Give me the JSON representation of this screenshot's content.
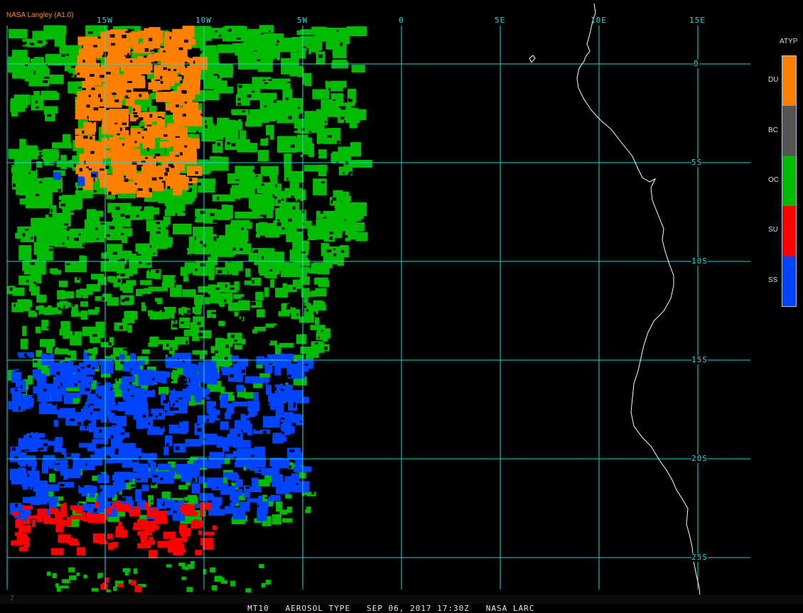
{
  "credit": "NASA Langley (A1.0)",
  "lon_labels": [
    "15W",
    "10W",
    "5W",
    "0",
    "5E",
    "10E",
    "15E"
  ],
  "lat_labels": [
    "0",
    "5S",
    "10S",
    "15S",
    "20S",
    "25S"
  ],
  "legend": {
    "title": "ATYP",
    "items": [
      {
        "label": "DU",
        "color": "#ff7f00"
      },
      {
        "label": "BC",
        "color": "#555555"
      },
      {
        "label": "OC",
        "color": "#00bb00"
      },
      {
        "label": "SU",
        "color": "#ff0000"
      },
      {
        "label": "SS",
        "color": "#0044ff"
      }
    ]
  },
  "footer": {
    "frame": "2",
    "product": "MT10",
    "title": "AEROSOL TYPE",
    "date": "SEP 06, 2017",
    "time": "17:30Z",
    "source": "NASA LARC"
  },
  "colors": {
    "grid": "#22d8e0",
    "coast": "#ffffff",
    "background": "#000000"
  }
}
